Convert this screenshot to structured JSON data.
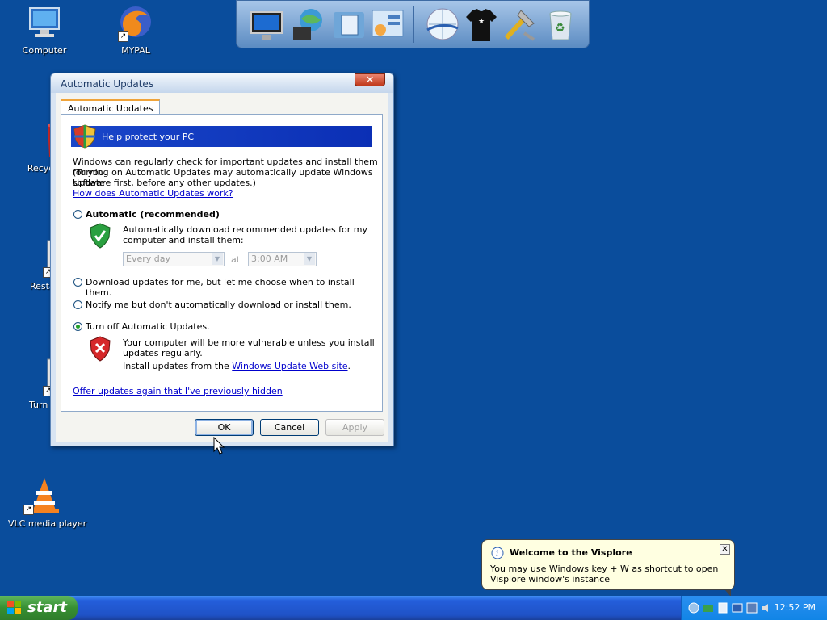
{
  "desktop": {
    "icons": [
      {
        "label": "Computer"
      },
      {
        "label": "MYPAL"
      },
      {
        "label": "Recycle"
      },
      {
        "label": "Resta"
      },
      {
        "label": "Turn O"
      },
      {
        "label": "VLC media player"
      }
    ]
  },
  "dock": {
    "items": [
      "monitor-icon",
      "globe-network-icon",
      "folder-documents-icon",
      "control-panel-icon",
      "web-globe-icon",
      "tshirt-icon",
      "tools-icon",
      "recycle-bin-icon"
    ]
  },
  "dialog": {
    "title": "Automatic Updates",
    "close_label": "✕",
    "tab": "Automatic Updates",
    "banner": "Help protect your PC",
    "intro_line1": "Windows can regularly check for important updates and install them for you.",
    "intro_line2": "(Turning on Automatic Updates may automatically update Windows Update",
    "intro_line3": "software first, before any other updates.)",
    "intro_link": "How does Automatic Updates work?",
    "options": {
      "automatic": {
        "label": "Automatic (recommended)",
        "selected": false
      },
      "automatic_desc1": "Automatically download recommended updates for my",
      "automatic_desc2": "computer and install them:",
      "day_select": "Every day",
      "at_label": "at",
      "time_select": "3:00 AM",
      "download": {
        "label": "Download updates for me, but let me choose when to install them.",
        "selected": false
      },
      "notify": {
        "label": "Notify me but don't automatically download or install them.",
        "selected": false
      },
      "off": {
        "label": "Turn off Automatic Updates.",
        "selected": true
      },
      "off_desc1": "Your computer will be more vulnerable unless you install",
      "off_desc2": "updates regularly.",
      "off_desc3_prefix": "Install updates from the ",
      "off_desc3_link": "Windows Update Web site",
      "off_desc3_suffix": "."
    },
    "offer_link": "Offer updates again that I've previously hidden",
    "buttons": {
      "ok": "OK",
      "cancel": "Cancel",
      "apply": "Apply"
    }
  },
  "balloon": {
    "title": "Welcome to the Visplore",
    "body": "You may use Windows key + W as shortcut to open Visplore window's instance",
    "close": "✕"
  },
  "taskbar": {
    "start_label": "start",
    "clock": "12:52 PM"
  },
  "colors": {
    "desktop": "#0a4d9c",
    "banner": "#1946c9",
    "taskbar": "#245edb",
    "start": "#378f33"
  }
}
